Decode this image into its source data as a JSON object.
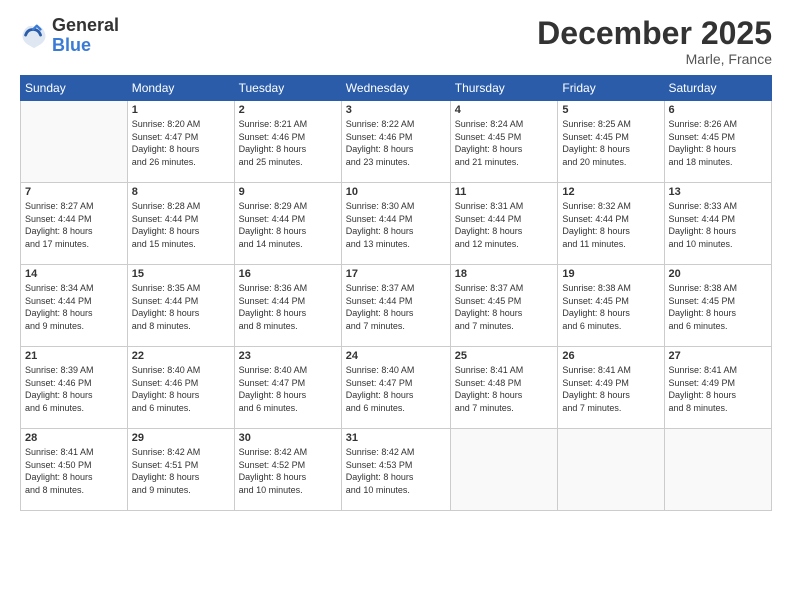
{
  "header": {
    "logo_line1": "General",
    "logo_line2": "Blue",
    "month": "December 2025",
    "location": "Marle, France"
  },
  "weekdays": [
    "Sunday",
    "Monday",
    "Tuesday",
    "Wednesday",
    "Thursday",
    "Friday",
    "Saturday"
  ],
  "weeks": [
    [
      {
        "day": "",
        "info": ""
      },
      {
        "day": "1",
        "info": "Sunrise: 8:20 AM\nSunset: 4:47 PM\nDaylight: 8 hours\nand 26 minutes."
      },
      {
        "day": "2",
        "info": "Sunrise: 8:21 AM\nSunset: 4:46 PM\nDaylight: 8 hours\nand 25 minutes."
      },
      {
        "day": "3",
        "info": "Sunrise: 8:22 AM\nSunset: 4:46 PM\nDaylight: 8 hours\nand 23 minutes."
      },
      {
        "day": "4",
        "info": "Sunrise: 8:24 AM\nSunset: 4:45 PM\nDaylight: 8 hours\nand 21 minutes."
      },
      {
        "day": "5",
        "info": "Sunrise: 8:25 AM\nSunset: 4:45 PM\nDaylight: 8 hours\nand 20 minutes."
      },
      {
        "day": "6",
        "info": "Sunrise: 8:26 AM\nSunset: 4:45 PM\nDaylight: 8 hours\nand 18 minutes."
      }
    ],
    [
      {
        "day": "7",
        "info": "Sunrise: 8:27 AM\nSunset: 4:44 PM\nDaylight: 8 hours\nand 17 minutes."
      },
      {
        "day": "8",
        "info": "Sunrise: 8:28 AM\nSunset: 4:44 PM\nDaylight: 8 hours\nand 15 minutes."
      },
      {
        "day": "9",
        "info": "Sunrise: 8:29 AM\nSunset: 4:44 PM\nDaylight: 8 hours\nand 14 minutes."
      },
      {
        "day": "10",
        "info": "Sunrise: 8:30 AM\nSunset: 4:44 PM\nDaylight: 8 hours\nand 13 minutes."
      },
      {
        "day": "11",
        "info": "Sunrise: 8:31 AM\nSunset: 4:44 PM\nDaylight: 8 hours\nand 12 minutes."
      },
      {
        "day": "12",
        "info": "Sunrise: 8:32 AM\nSunset: 4:44 PM\nDaylight: 8 hours\nand 11 minutes."
      },
      {
        "day": "13",
        "info": "Sunrise: 8:33 AM\nSunset: 4:44 PM\nDaylight: 8 hours\nand 10 minutes."
      }
    ],
    [
      {
        "day": "14",
        "info": "Sunrise: 8:34 AM\nSunset: 4:44 PM\nDaylight: 8 hours\nand 9 minutes."
      },
      {
        "day": "15",
        "info": "Sunrise: 8:35 AM\nSunset: 4:44 PM\nDaylight: 8 hours\nand 8 minutes."
      },
      {
        "day": "16",
        "info": "Sunrise: 8:36 AM\nSunset: 4:44 PM\nDaylight: 8 hours\nand 8 minutes."
      },
      {
        "day": "17",
        "info": "Sunrise: 8:37 AM\nSunset: 4:44 PM\nDaylight: 8 hours\nand 7 minutes."
      },
      {
        "day": "18",
        "info": "Sunrise: 8:37 AM\nSunset: 4:45 PM\nDaylight: 8 hours\nand 7 minutes."
      },
      {
        "day": "19",
        "info": "Sunrise: 8:38 AM\nSunset: 4:45 PM\nDaylight: 8 hours\nand 6 minutes."
      },
      {
        "day": "20",
        "info": "Sunrise: 8:38 AM\nSunset: 4:45 PM\nDaylight: 8 hours\nand 6 minutes."
      }
    ],
    [
      {
        "day": "21",
        "info": "Sunrise: 8:39 AM\nSunset: 4:46 PM\nDaylight: 8 hours\nand 6 minutes."
      },
      {
        "day": "22",
        "info": "Sunrise: 8:40 AM\nSunset: 4:46 PM\nDaylight: 8 hours\nand 6 minutes."
      },
      {
        "day": "23",
        "info": "Sunrise: 8:40 AM\nSunset: 4:47 PM\nDaylight: 8 hours\nand 6 minutes."
      },
      {
        "day": "24",
        "info": "Sunrise: 8:40 AM\nSunset: 4:47 PM\nDaylight: 8 hours\nand 6 minutes."
      },
      {
        "day": "25",
        "info": "Sunrise: 8:41 AM\nSunset: 4:48 PM\nDaylight: 8 hours\nand 7 minutes."
      },
      {
        "day": "26",
        "info": "Sunrise: 8:41 AM\nSunset: 4:49 PM\nDaylight: 8 hours\nand 7 minutes."
      },
      {
        "day": "27",
        "info": "Sunrise: 8:41 AM\nSunset: 4:49 PM\nDaylight: 8 hours\nand 8 minutes."
      }
    ],
    [
      {
        "day": "28",
        "info": "Sunrise: 8:41 AM\nSunset: 4:50 PM\nDaylight: 8 hours\nand 8 minutes."
      },
      {
        "day": "29",
        "info": "Sunrise: 8:42 AM\nSunset: 4:51 PM\nDaylight: 8 hours\nand 9 minutes."
      },
      {
        "day": "30",
        "info": "Sunrise: 8:42 AM\nSunset: 4:52 PM\nDaylight: 8 hours\nand 10 minutes."
      },
      {
        "day": "31",
        "info": "Sunrise: 8:42 AM\nSunset: 4:53 PM\nDaylight: 8 hours\nand 10 minutes."
      },
      {
        "day": "",
        "info": ""
      },
      {
        "day": "",
        "info": ""
      },
      {
        "day": "",
        "info": ""
      }
    ]
  ]
}
